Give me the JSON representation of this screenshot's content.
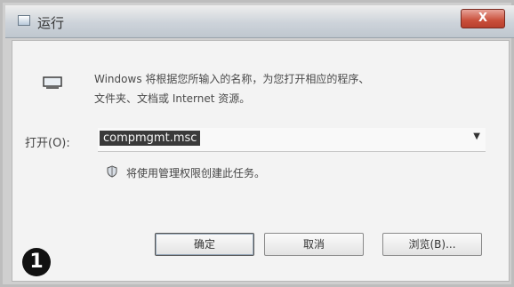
{
  "window": {
    "title": "运行",
    "close_label": "X"
  },
  "body": {
    "description_line1": "Windows 将根据您所输入的名称，为您打开相应的程序、",
    "description_line2": "文件夹、文档或 Internet 资源。",
    "open_label": "打开(O):",
    "command_value": "compmgmt.msc",
    "admin_note": "将使用管理权限创建此任务。"
  },
  "buttons": {
    "ok": "确定",
    "cancel": "取消",
    "browse": "浏览(B)..."
  },
  "step_badge": "1",
  "icons": {
    "title": "run-dialog-icon",
    "run": "run-program-icon",
    "admin": "shield-icon",
    "dropdown": "chevron-down-icon"
  }
}
